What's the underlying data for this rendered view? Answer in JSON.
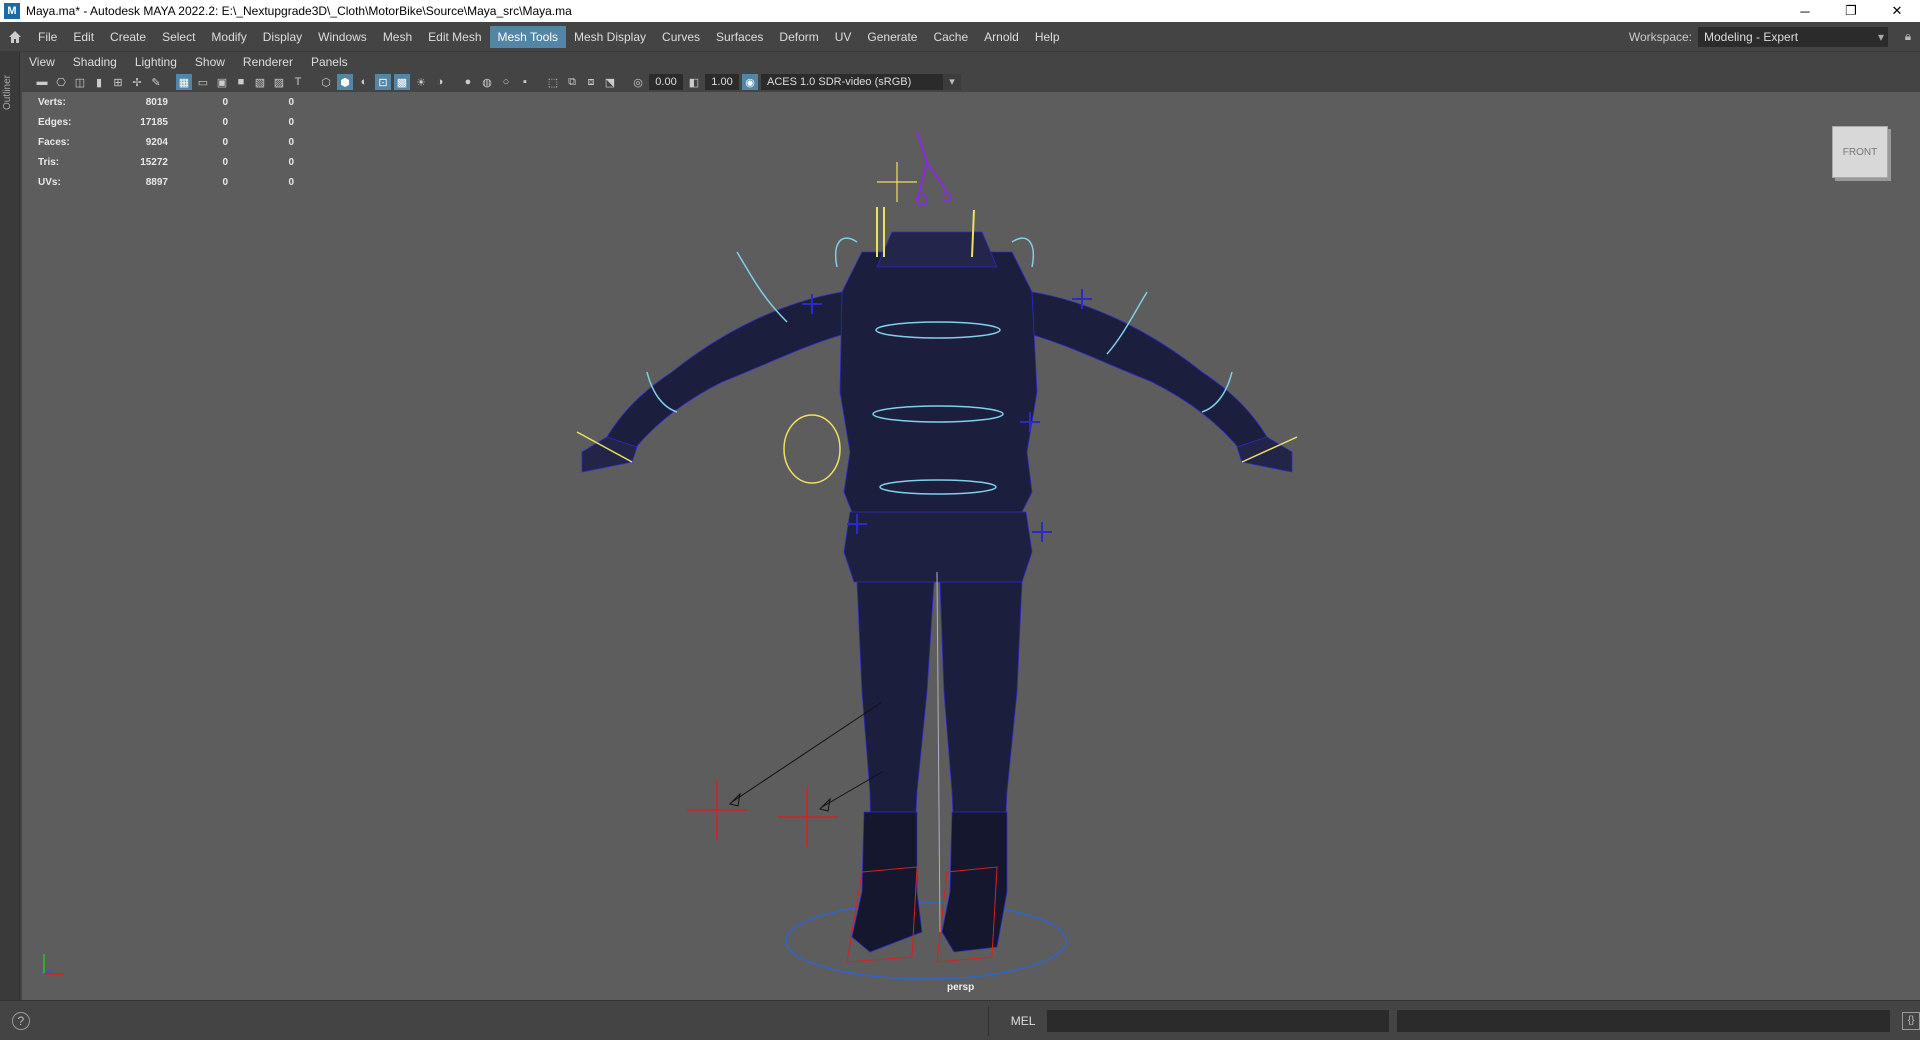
{
  "window": {
    "title": "Maya.ma* - Autodesk MAYA 2022.2: E:\\_Nextupgrade3D\\_Cloth\\MotorBike\\Source\\Maya_src\\Maya.ma",
    "app_icon": "M",
    "minimize": "─",
    "restore": "❐",
    "close": "✕"
  },
  "menubar": {
    "items": [
      "File",
      "Edit",
      "Create",
      "Select",
      "Modify",
      "Display",
      "Windows",
      "Mesh",
      "Edit Mesh",
      "Mesh Tools",
      "Mesh Display",
      "Curves",
      "Surfaces",
      "Deform",
      "UV",
      "Generate",
      "Cache",
      "Arnold",
      "Help"
    ],
    "active": "Mesh Tools",
    "workspace_label": "Workspace:",
    "workspace_value": "Modeling - Expert"
  },
  "outliner_tab": "Outliner",
  "panel_menu": [
    "View",
    "Shading",
    "Lighting",
    "Show",
    "Renderer",
    "Panels"
  ],
  "panel_toolbar": {
    "exposure": "0.00",
    "gamma": "1.00",
    "color_space": "ACES 1.0 SDR-video (sRGB)"
  },
  "hud": [
    {
      "label": "Verts:",
      "v1": "8019",
      "v2": "0",
      "v3": "0"
    },
    {
      "label": "Edges:",
      "v1": "17185",
      "v2": "0",
      "v3": "0"
    },
    {
      "label": "Faces:",
      "v1": "9204",
      "v2": "0",
      "v3": "0"
    },
    {
      "label": "Tris:",
      "v1": "15272",
      "v2": "0",
      "v3": "0"
    },
    {
      "label": "UVs:",
      "v1": "8897",
      "v2": "0",
      "v3": "0"
    }
  ],
  "viewcube_label": "FRONT",
  "camera_label": "persp",
  "bottom": {
    "help": "?",
    "mel_label": "MEL"
  },
  "colors": {
    "active_menu": "#5285a6",
    "viewport_bg": "#5d5d5d",
    "mesh_dark": "#1c1e3e",
    "wire": "#2a2ac8",
    "control_yellow": "#f0e060",
    "control_cyan": "#7fd0e8",
    "locator_red": "#d82020"
  }
}
